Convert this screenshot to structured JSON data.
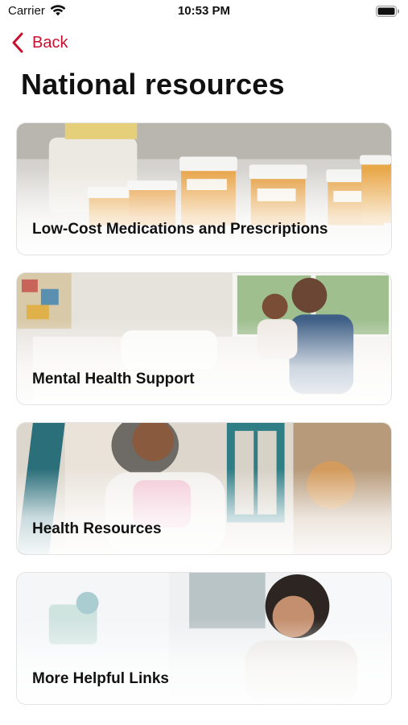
{
  "status_bar": {
    "carrier": "Carrier",
    "time": "10:53 PM",
    "icons": [
      "wifi-icon",
      "battery-icon"
    ]
  },
  "nav": {
    "back_label": "Back",
    "back_icon": "chevron-left-icon",
    "accent": "#c8102e"
  },
  "page": {
    "title": "National resources"
  },
  "cards": [
    {
      "label": "Low-Cost Medications and Prescriptions",
      "image": "prescription-bottles-photo"
    },
    {
      "label": "Mental Health Support",
      "image": "father-and-daughter-photo"
    },
    {
      "label": "Health Resources",
      "image": "smiling-woman-photo"
    },
    {
      "label": "More Helpful Links",
      "image": "woman-reading-photo"
    }
  ]
}
